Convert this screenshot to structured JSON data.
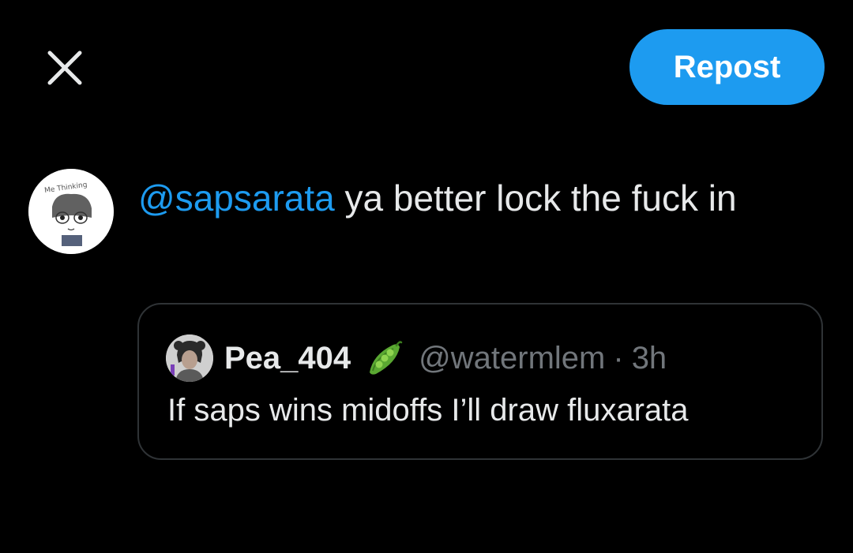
{
  "header": {
    "close_icon": "close-icon",
    "repost_label": "Repost"
  },
  "compose": {
    "avatar_icon": "user-avatar-sketch",
    "avatar_caption": "Me Thinking",
    "mention": "@sapsarata",
    "text": " ya better lock the fuck in"
  },
  "quote": {
    "avatar_icon": "user-avatar",
    "name": "Pea_404",
    "name_emoji": "pea-pod-emoji",
    "handle": "@watermlem",
    "separator": "·",
    "time": "3h",
    "body": "If saps wins midoffs I’ll draw fluxarata"
  },
  "colors": {
    "background": "#000000",
    "accent": "#1d9bf0",
    "text_primary": "#e7e9ea",
    "text_secondary": "#71767b",
    "border": "#2f3336"
  }
}
